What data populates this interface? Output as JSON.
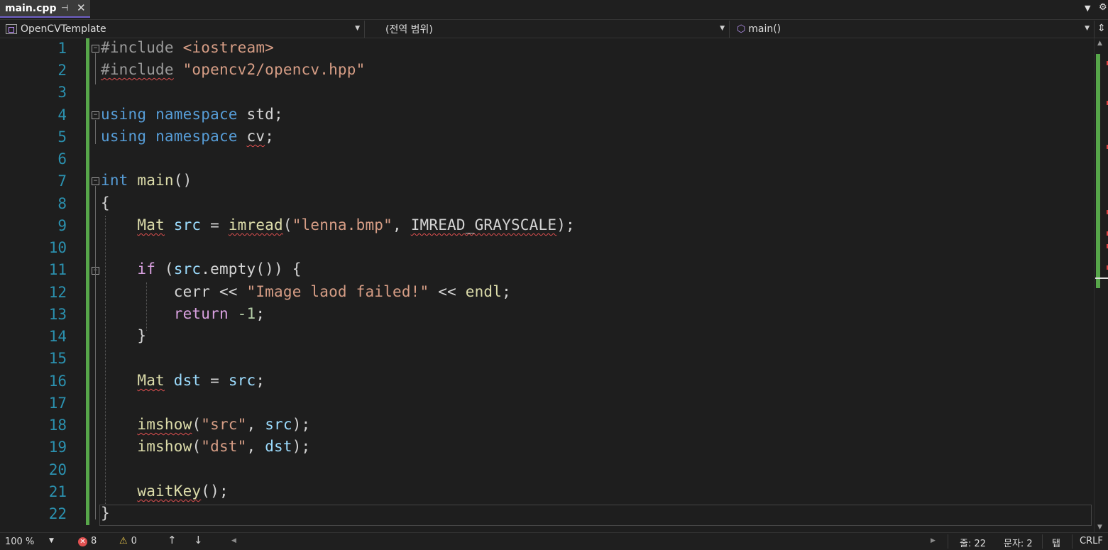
{
  "tab": {
    "title": "main.cpp",
    "pin_icon": "pin-icon",
    "close_icon": "close-icon"
  },
  "navbar": {
    "project": "OpenCVTemplate",
    "scope": "(전역 범위)",
    "member": "main()"
  },
  "editor": {
    "lines": [
      {
        "n": "1"
      },
      {
        "n": "2"
      },
      {
        "n": "3"
      },
      {
        "n": "4"
      },
      {
        "n": "5"
      },
      {
        "n": "6"
      },
      {
        "n": "7"
      },
      {
        "n": "8"
      },
      {
        "n": "9"
      },
      {
        "n": "10"
      },
      {
        "n": "11"
      },
      {
        "n": "12"
      },
      {
        "n": "13"
      },
      {
        "n": "14"
      },
      {
        "n": "15"
      },
      {
        "n": "16"
      },
      {
        "n": "17"
      },
      {
        "n": "18"
      },
      {
        "n": "19"
      },
      {
        "n": "20"
      },
      {
        "n": "21"
      },
      {
        "n": "22"
      }
    ],
    "code": [
      "#include <iostream>",
      "#include \"opencv2/opencv.hpp\"",
      "",
      "using namespace std;",
      "using namespace cv;",
      "",
      "int main()",
      "{",
      "    Mat src = imread(\"lenna.bmp\", IMREAD_GRAYSCALE);",
      "",
      "    if (src.empty()) {",
      "        cerr << \"Image laod failed!\" << endl;",
      "        return -1;",
      "    }",
      "",
      "    Mat dst = src;",
      "",
      "    imshow(\"src\", src);",
      "    imshow(\"dst\", dst);",
      "",
      "    waitKey();",
      "}"
    ],
    "tokens": {
      "include": "#include",
      "iostream": "<iostream>",
      "opencv_hpp": "\"opencv2/opencv.hpp\"",
      "using": "using",
      "namespace": "namespace",
      "std": "std",
      "cv": "cv",
      "int": "int",
      "main": "main",
      "mat": "Mat",
      "src": "src",
      "imread": "imread",
      "lenna": "\"lenna.bmp\"",
      "grayscale": "IMREAD_GRAYSCALE",
      "if": "if",
      "empty": "empty",
      "cerr": "cerr",
      "fail_msg": "\"Image laod failed!\"",
      "endl": "endl",
      "return": "return",
      "neg_one": "-1",
      "dst": "dst",
      "imshow": "imshow",
      "src_str": "\"src\"",
      "dst_str": "\"dst\"",
      "waitkey": "waitKey"
    }
  },
  "status": {
    "zoom": "100 %",
    "errors": "8",
    "warnings": "0",
    "line": "줄: 22",
    "char": "문자: 2",
    "indent": "탭",
    "eol": "CRLF"
  },
  "colors": {
    "accent": "#7060c8",
    "change_bar": "#57a64a",
    "line_number": "#2b91af",
    "keyword": "#569cd6",
    "string": "#d69d85",
    "error": "#e05050"
  }
}
